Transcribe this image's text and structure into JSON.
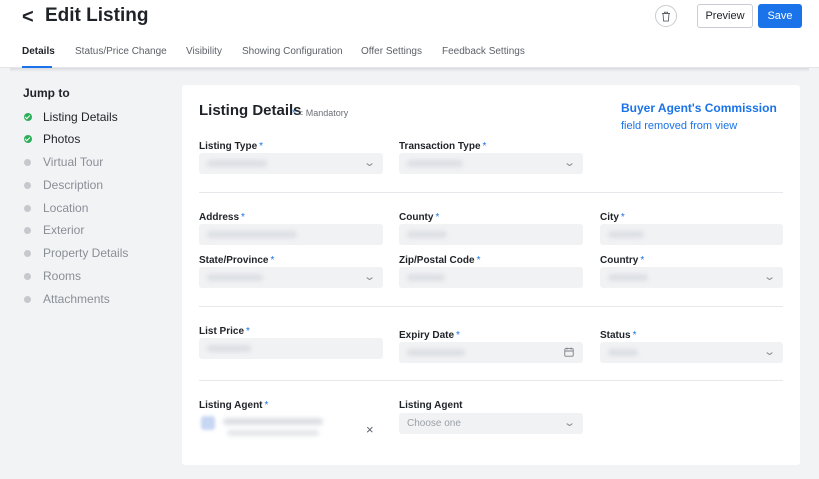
{
  "header": {
    "back_glyph": "<",
    "title": "Edit Listing",
    "preview_label": "Preview",
    "save_label": "Save",
    "delete_icon": "trash-icon",
    "accent_color": "#1a73e8"
  },
  "tabs": [
    {
      "label": "Details",
      "active": true
    },
    {
      "label": "Status/Price Change"
    },
    {
      "label": "Visibility"
    },
    {
      "label": "Showing Configuration"
    },
    {
      "label": "Offer Settings"
    },
    {
      "label": "Feedback Settings"
    }
  ],
  "sidebar": {
    "title": "Jump to",
    "items": [
      {
        "label": "Listing Details",
        "status": "complete"
      },
      {
        "label": "Photos",
        "status": "complete"
      },
      {
        "label": "Virtual Tour",
        "status": "incomplete"
      },
      {
        "label": "Description",
        "status": "incomplete"
      },
      {
        "label": "Location",
        "status": "incomplete"
      },
      {
        "label": "Exterior",
        "status": "incomplete"
      },
      {
        "label": "Property Details",
        "status": "incomplete"
      },
      {
        "label": "Rooms",
        "status": "incomplete"
      },
      {
        "label": "Attachments",
        "status": "incomplete"
      }
    ]
  },
  "form": {
    "title": "Listing Details",
    "mandatory_star": "*",
    "mandatory_note": " = Mandatory",
    "commission_title": "Buyer Agent's Commission",
    "commission_subtitle": "field removed from view",
    "required_marker": "*",
    "fields": {
      "listing_type": "Listing Type",
      "transaction_type": "Transaction Type",
      "address": "Address",
      "county": "County",
      "city": "City",
      "state": "State/Province",
      "zip": "Zip/Postal Code",
      "country": "Country",
      "list_price": "List Price",
      "expiry_date": "Expiry Date",
      "status": "Status",
      "listing_agent_required": "Listing Agent",
      "listing_agent_secondary": "Listing Agent"
    },
    "secondary_agent_placeholder": "Choose one",
    "clear_glyph": "×",
    "chevron_glyph": "⌄"
  }
}
